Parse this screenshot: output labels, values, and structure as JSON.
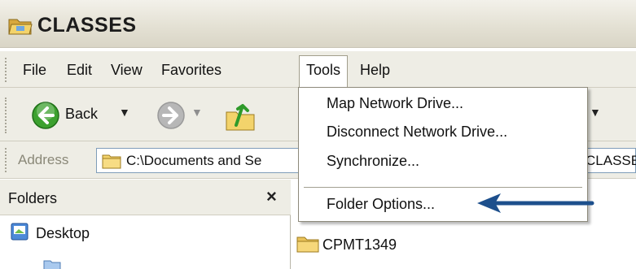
{
  "window": {
    "title": "CLASSES"
  },
  "menubar": {
    "items": [
      {
        "label": "File"
      },
      {
        "label": "Edit"
      },
      {
        "label": "View"
      },
      {
        "label": "Favorites"
      },
      {
        "label": "Tools"
      },
      {
        "label": "Help"
      }
    ],
    "active": "Tools"
  },
  "toolbar": {
    "back_label": "Back"
  },
  "address": {
    "label": "Address",
    "value_left": "C:\\Documents and Se",
    "value_right": "CLASSE"
  },
  "folders_pane": {
    "title": "Folders",
    "close_glyph": "×",
    "tree": [
      {
        "label": "Desktop"
      }
    ]
  },
  "content": {
    "items": [
      {
        "label": "CPMT1349"
      }
    ]
  },
  "tools_menu": {
    "items": [
      {
        "label": "Map Network Drive..."
      },
      {
        "label": "Disconnect Network Drive..."
      },
      {
        "label": "Synchronize..."
      },
      {
        "label": "Folder Options..."
      }
    ]
  },
  "icons": {
    "title": "folder-open-icon",
    "back": "back-arrow-icon",
    "forward": "forward-arrow-icon",
    "up": "up-folder-icon",
    "address": "folder-icon",
    "desktop": "desktop-icon",
    "file": "folder-icon",
    "annotation": "arrow-left-icon"
  },
  "colors": {
    "back_green": "#3ca12f",
    "forward_gray": "#b7b7b7",
    "folder_yellow": "#f3d36b",
    "arrow_blue": "#1d4f8c",
    "chrome": "#eeede5"
  }
}
